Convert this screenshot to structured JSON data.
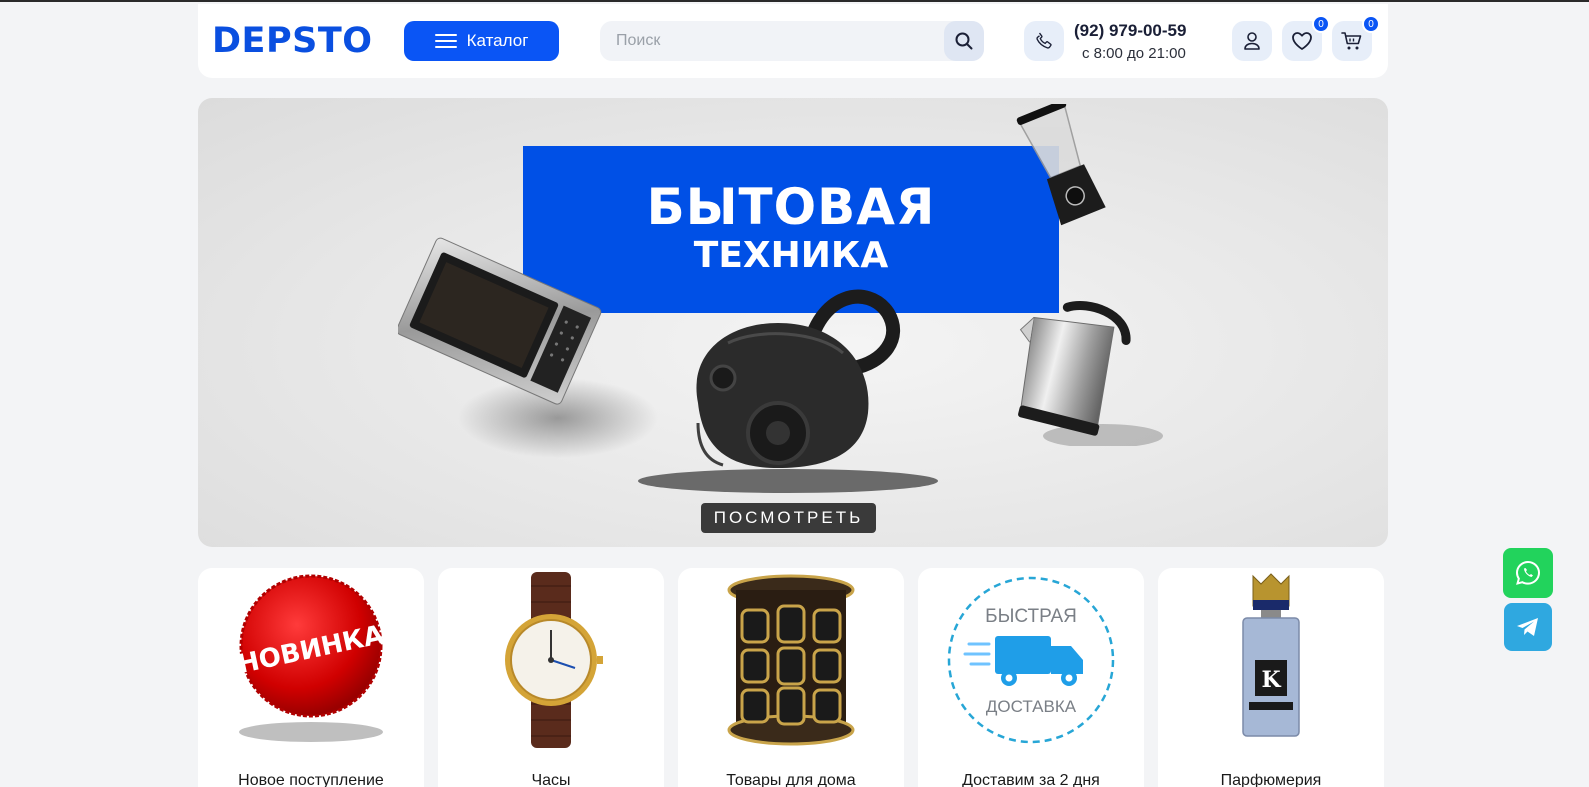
{
  "header": {
    "logo": "DEPSTO",
    "catalog_label": "Каталог",
    "search_placeholder": "Поиск",
    "phone_number": "(92) 979-00-59",
    "phone_hours": "с 8:00 до 21:00",
    "favorites_count": "0",
    "cart_count": "0",
    "icons": {
      "catalog": "hamburger-icon",
      "search": "search-icon",
      "phone": "phone-icon",
      "profile": "user-icon",
      "favorites": "heart-icon",
      "cart": "cart-icon"
    }
  },
  "banner": {
    "title_line1": "БЫТОВАЯ",
    "title_line2": "ТЕХНИКА",
    "cta_label": "ПОСМОТРЕТЬ",
    "appliances": [
      "microwave",
      "vacuum-cleaner",
      "blender",
      "kettle"
    ]
  },
  "categories": [
    {
      "label": "Новое поступление",
      "image": "new-arrival-badge",
      "badge_text": "НОВИНКА"
    },
    {
      "label": "Часы",
      "image": "wristwatch"
    },
    {
      "label": "Товары для дома",
      "image": "spice-rack"
    },
    {
      "label": "Доставим за 2 дня",
      "image": "fast-delivery-truck",
      "text_top": "БЫСТРАЯ",
      "text_bottom": "ДОСТАВКА"
    },
    {
      "label": "Парфюмерия",
      "image": "perfume-bottle"
    }
  ],
  "floating": {
    "whatsapp_icon": "whatsapp-icon",
    "telegram_icon": "telegram-icon"
  },
  "colors": {
    "brand_blue": "#0a55f5",
    "whatsapp_green": "#22d35c",
    "telegram_blue": "#2fa8e0",
    "page_bg": "#f3f4f6"
  }
}
